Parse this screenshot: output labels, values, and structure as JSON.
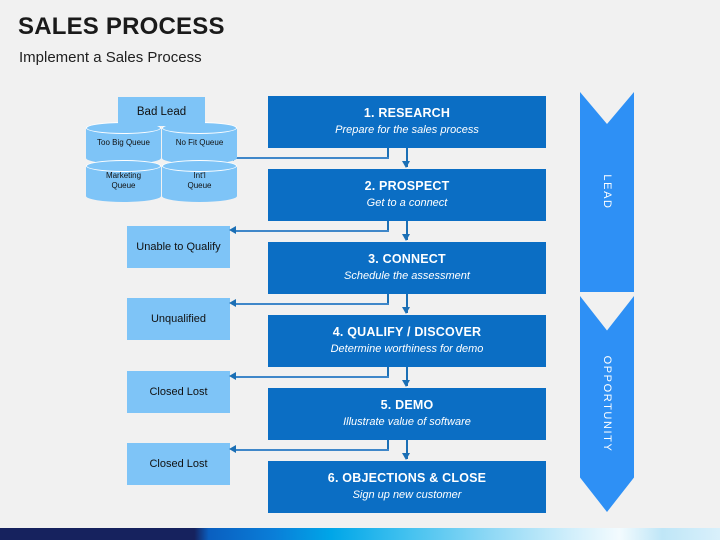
{
  "header": {
    "title": "SALES PROCESS",
    "subtitle": "Implement a Sales Process"
  },
  "colors": {
    "background": "#f1f1f1",
    "step_fill": "#0b6ec4",
    "exit_fill": "#7ec4f7",
    "banner_fill": "#2e90f5",
    "connector": "#1b6fb5",
    "text_dark": "#1a1a1a",
    "text_light": "#ffffff"
  },
  "steps": [
    {
      "title": "1. RESEARCH",
      "subtitle": "Prepare for the sales process"
    },
    {
      "title": "2. PROSPECT",
      "subtitle": "Get to a connect"
    },
    {
      "title": "3. CONNECT",
      "subtitle": "Schedule the assessment"
    },
    {
      "title": "4. QUALIFY / DISCOVER",
      "subtitle": "Determine worthiness for demo"
    },
    {
      "title": "5. DEMO",
      "subtitle": "Illustrate value of software"
    },
    {
      "title": "6. OBJECTIONS & CLOSE",
      "subtitle": "Sign up new customer"
    }
  ],
  "bad_lead": {
    "label": "Bad Lead"
  },
  "queues": [
    {
      "label": "Too Big Queue"
    },
    {
      "label": "No Fit Queue"
    },
    {
      "label": "Marketing\nQueue"
    },
    {
      "label": "Int'l\nQueue"
    }
  ],
  "exits": [
    {
      "label": "Unable to Qualify"
    },
    {
      "label": "Unqualified"
    },
    {
      "label": "Closed Lost"
    },
    {
      "label": "Closed Lost"
    }
  ],
  "banners": [
    {
      "label": "LEAD"
    },
    {
      "label": "OPPORTUNITY"
    }
  ]
}
